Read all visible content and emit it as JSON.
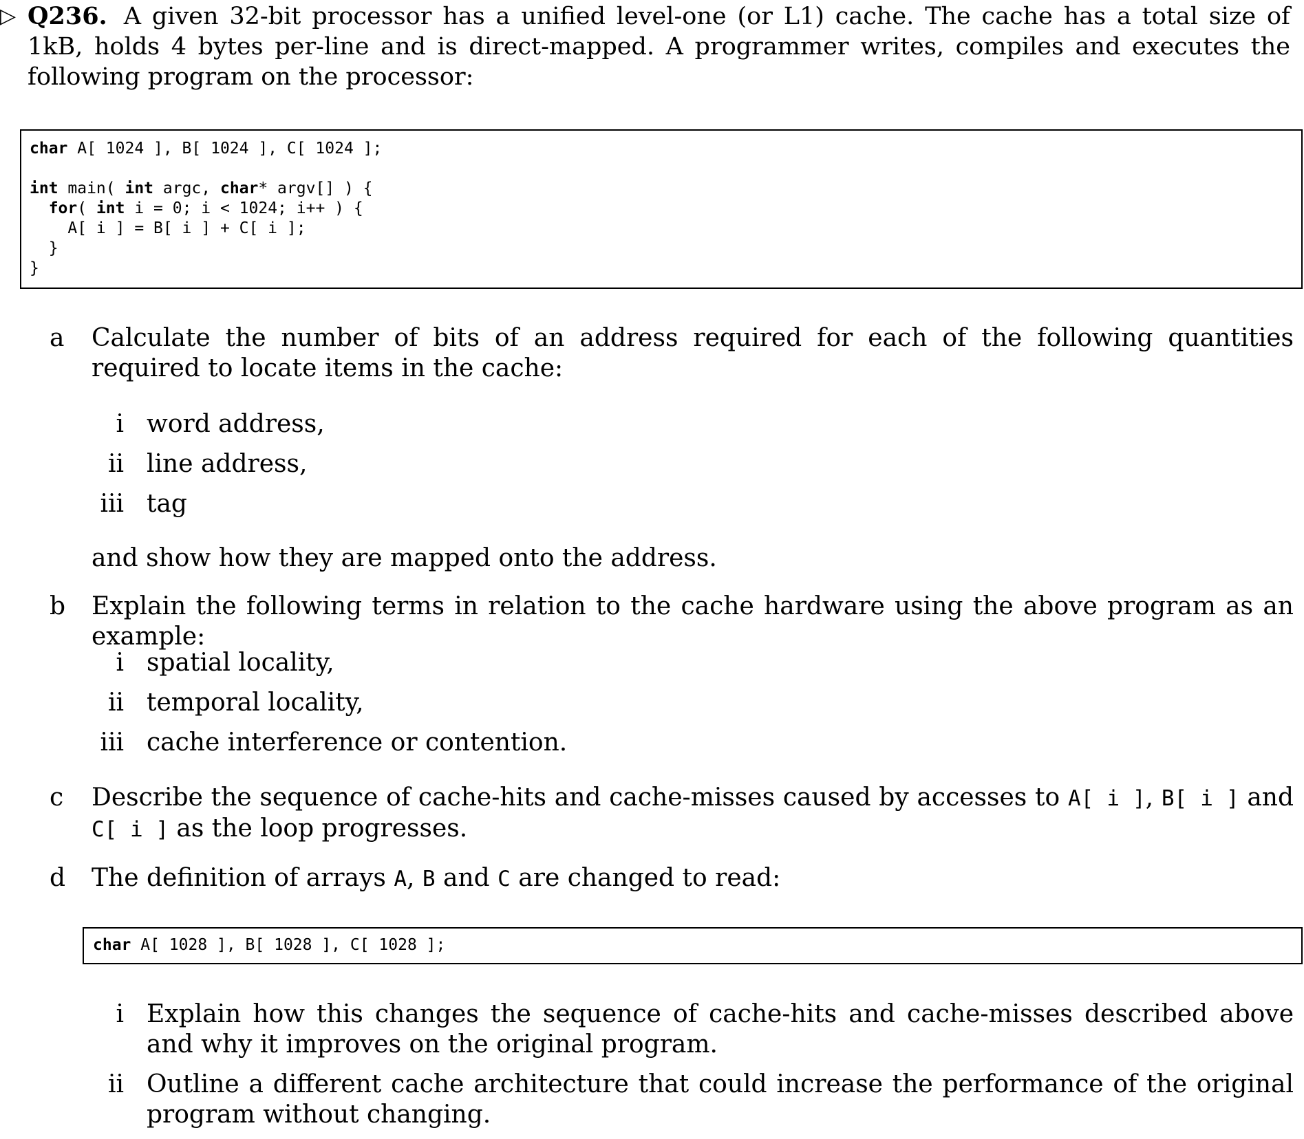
{
  "question": {
    "marker": "▷",
    "number": "Q236.",
    "intro": "A given 32-bit processor has a unified level-one (or L1) cache. The cache has a total size of 1kB, holds 4 bytes per-line and is direct-mapped. A programmer writes, compiles and executes the following program on the processor:"
  },
  "code_main": {
    "l1": {
      "kw": "char",
      "rest": " A[ 1024 ], B[ 1024 ], C[ 1024 ];"
    },
    "l2": {
      "kw1": "int",
      "a": " main( ",
      "kw2": "int",
      "b": " argc, ",
      "kw3": "char",
      "c": "* argv[] ) {"
    },
    "l3": {
      "a": "  ",
      "kw1": "for",
      "b": "( ",
      "kw2": "int",
      "c": " i = 0; i < 1024; i++ ) {"
    },
    "l4": "    A[ i ] = B[ i ] + C[ i ];",
    "l5": "  }",
    "l6": "}"
  },
  "part_a": {
    "label": "a",
    "text": "Calculate the number of bits of an address required for each of the following quantities required to locate items in the cache:",
    "items": [
      {
        "label": "i",
        "text": "word address,"
      },
      {
        "label": "ii",
        "text": "line address,"
      },
      {
        "label": "iii",
        "text": "tag"
      }
    ],
    "after": "and show how they are mapped onto the address."
  },
  "part_b": {
    "label": "b",
    "text": "Explain the following terms in relation to the cache hardware using the above program as an example:",
    "items": [
      {
        "label": "i",
        "text": "spatial locality,"
      },
      {
        "label": "ii",
        "text": "temporal locality,"
      },
      {
        "label": "iii",
        "text": "cache interference or contention."
      }
    ]
  },
  "part_c": {
    "label": "c",
    "t1": "Describe the sequence of cache-hits and cache-misses caused by accesses to ",
    "c1": "A[ i ]",
    "t2": ", ",
    "c2": "B[ i ]",
    "t3": " and ",
    "c3": "C[ i ]",
    "t4": " as the loop progresses."
  },
  "part_d": {
    "label": "d",
    "t1": "The definition of arrays ",
    "c1": "A",
    "t2": ", ",
    "c2": "B",
    "t3": " and ",
    "c3": "C",
    "t4": " are changed to read:",
    "code": {
      "kw": "char",
      "rest": " A[ 1028 ], B[ 1028 ], C[ 1028 ];"
    },
    "items": [
      {
        "label": "i",
        "text": "Explain how this changes the sequence of cache-hits and cache-misses described above and why it improves on the original program."
      },
      {
        "label": "ii",
        "text": "Outline a different cache architecture that could increase the performance of the original program without changing."
      }
    ]
  }
}
